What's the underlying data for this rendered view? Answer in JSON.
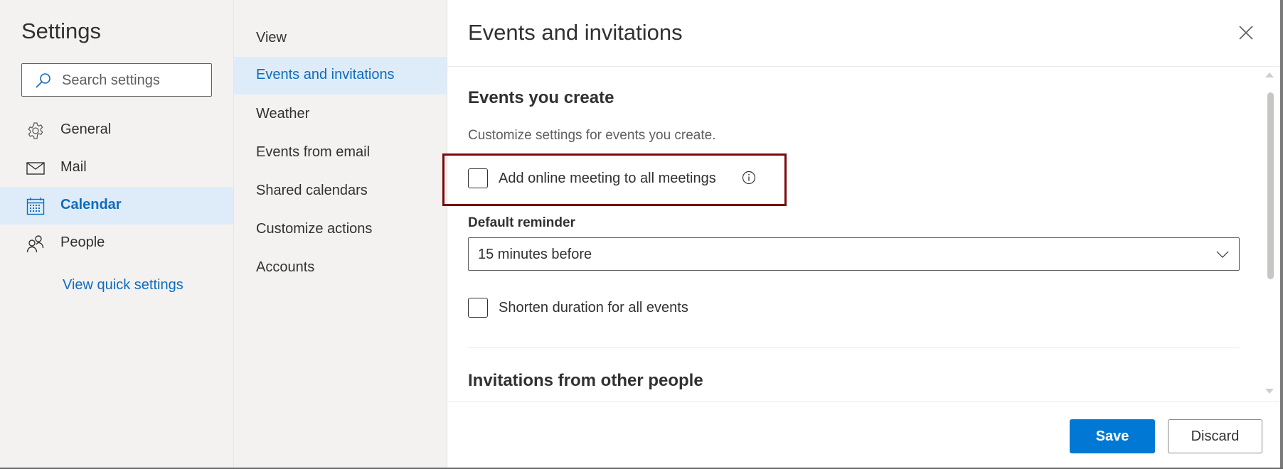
{
  "sidebar": {
    "title": "Settings",
    "search": {
      "placeholder": "Search settings",
      "value": "",
      "icon": "search-icon"
    },
    "items": [
      {
        "label": "General",
        "icon": "gear-icon",
        "active": false
      },
      {
        "label": "Mail",
        "icon": "mail-icon",
        "active": false
      },
      {
        "label": "Calendar",
        "icon": "calendar-icon",
        "active": true
      },
      {
        "label": "People",
        "icon": "people-icon",
        "active": false
      }
    ],
    "quick_settings_link": "View quick settings"
  },
  "subnav": {
    "items": [
      {
        "label": "View",
        "active": false
      },
      {
        "label": "Events and invitations",
        "active": true
      },
      {
        "label": "Weather",
        "active": false
      },
      {
        "label": "Events from email",
        "active": false
      },
      {
        "label": "Shared calendars",
        "active": false
      },
      {
        "label": "Customize actions",
        "active": false
      },
      {
        "label": "Accounts",
        "active": false
      }
    ]
  },
  "panel": {
    "title": "Events and invitations",
    "close_icon": "close-icon",
    "section1": {
      "title": "Events you create",
      "description": "Customize settings for events you create.",
      "online_meeting": {
        "label": "Add online meeting to all meetings",
        "checked": false,
        "info_icon": "info-icon"
      },
      "default_reminder": {
        "label": "Default reminder",
        "value": "15 minutes before"
      },
      "shorten_duration": {
        "label": "Shorten duration for all events",
        "checked": false
      }
    },
    "section2": {
      "title": "Invitations from other people"
    },
    "footer": {
      "save_label": "Save",
      "discard_label": "Discard"
    }
  },
  "colors": {
    "accent": "#0078d4",
    "link": "#0f6cbd",
    "selection_bg": "#deecf9",
    "nav_bg": "#f3f2f1",
    "highlight_border": "#7a0a0a"
  }
}
